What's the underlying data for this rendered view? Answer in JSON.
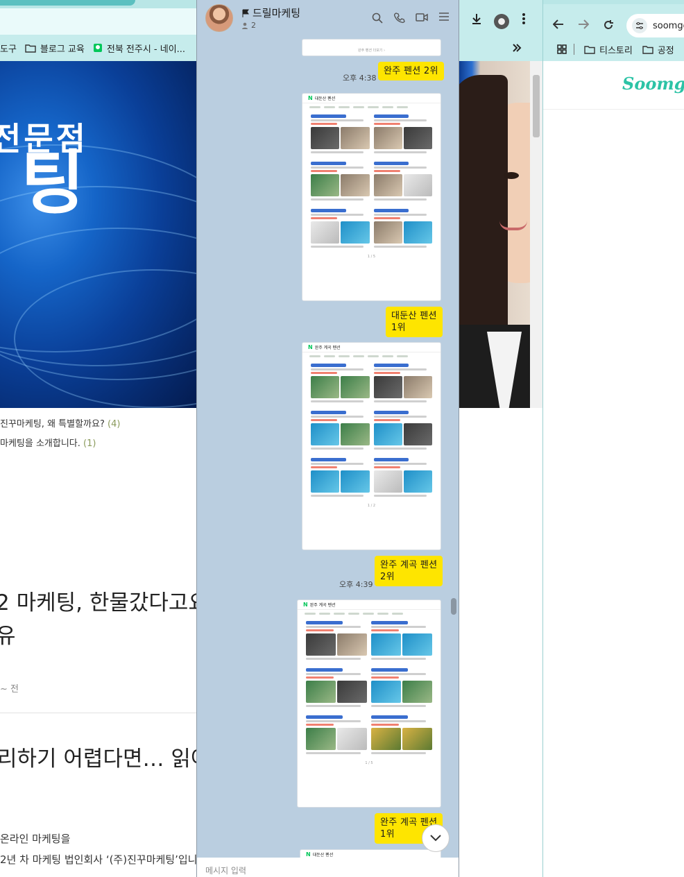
{
  "left_browser": {
    "bookmarks": [
      "도구",
      "블로그 교육",
      "전북 전주시 - 네이..."
    ],
    "hero": {
      "line1": "전문점",
      "line2": "팅"
    },
    "posts": [
      {
        "title": "진꾸마케팅, 왜 특별할까요?",
        "count": "(4)"
      },
      {
        "title": "마케팅을 소개합니다.",
        "count": "(1)"
      }
    ],
    "article": {
      "title_line1": "2 마케팅, 한물갔다고요",
      "title_line2": "유",
      "meta": "~ 전",
      "title2": "리하기 어렵다면… 읽어보",
      "para1": "온라인 마케팅을",
      "para2": "2년 차 마케팅 법인회사 ‘(주)진꾸마케팅’입니"
    }
  },
  "chat": {
    "room_name": "드릴마케팅",
    "member_count": "2",
    "input_placeholder": "메시지 입력",
    "messages": [
      {
        "type": "bubble",
        "text": "완주 펜션 2위"
      },
      {
        "type": "time",
        "text": "오후 4:38"
      },
      {
        "type": "screenshot",
        "header": "대둔산 펜션",
        "pager": "1 / 5"
      },
      {
        "type": "bubble",
        "text": "대둔산 펜션\n1위"
      },
      {
        "type": "screenshot",
        "header": "완주 계곡 펜션",
        "pager": "1 / 2"
      },
      {
        "type": "bubble",
        "text": "완주 계곡 펜션\n2위"
      },
      {
        "type": "time",
        "text": "오후 4:39"
      },
      {
        "type": "screenshot",
        "header": "완주 계곡 펜션",
        "pager": "1 / 5"
      },
      {
        "type": "bubble",
        "text": "완주 계곡 펜션\n1위"
      },
      {
        "type": "screenshot",
        "header": "대둔산 펜션",
        "pager": ""
      }
    ],
    "top_screenshot_caption": "완주 펜션 더보기 ›"
  },
  "right_browser": {
    "url": "soomgo",
    "bookmarks": [
      "티스토리",
      "공정"
    ],
    "logo": "Soomgo"
  },
  "colors": {
    "chat_bg": "#bacee0",
    "bubble": "#fee500",
    "browser_frame": "#c6ecec",
    "soomgo": "#2cc3a6"
  },
  "icons": [
    "flag-icon",
    "person-icon",
    "search-icon",
    "phone-icon",
    "video-icon",
    "menu-icon",
    "download-icon",
    "back-icon",
    "forward-icon",
    "reload-icon",
    "folder-icon",
    "apps-icon",
    "chevron-down-icon"
  ]
}
